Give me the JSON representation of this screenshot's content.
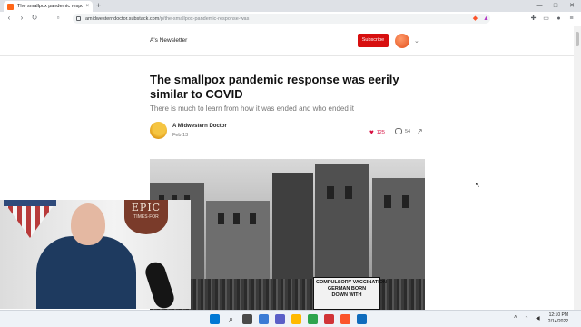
{
  "browser": {
    "tab_title": "The smallpox pandemic respons",
    "tab_close": "×",
    "new_tab": "+",
    "url_host": "amidwesterndoctor.substack.com",
    "url_path": "/p/the-smallpox-pandemic-response-was",
    "window_controls": {
      "minimize": "—",
      "maximize": "□",
      "close": "✕"
    }
  },
  "header": {
    "newsletter_name": "A's Newsletter",
    "subscribe_label": "Subscribe"
  },
  "post": {
    "title": "The smallpox pandemic response was eerily similar to COVID",
    "subtitle": "There is much to learn from how it was ended and who ended it",
    "author": "A Midwestern Doctor",
    "date": "Feb 13",
    "likes": "125",
    "comments": "54"
  },
  "hero_image": {
    "sign_lines": [
      "COMPULSORY VACCINATION",
      "GERMAN BORN",
      "DOWN WITH"
    ]
  },
  "webcam": {
    "logo_big": "EPIC",
    "logo_small": "TIMES·FOR"
  },
  "taskbar": {
    "time": "12:10 PM",
    "date": "2/14/2022"
  },
  "icons": [
    "substack-favicon",
    "back-icon",
    "forward-icon",
    "reload-icon",
    "lock-icon",
    "brave-shield-icon",
    "rewards-icon",
    "extensions-icon",
    "profile-icon",
    "menu-icon",
    "heart-icon",
    "comment-icon",
    "share-icon",
    "chevron-down-icon",
    "windows-start-icon",
    "search-icon"
  ]
}
